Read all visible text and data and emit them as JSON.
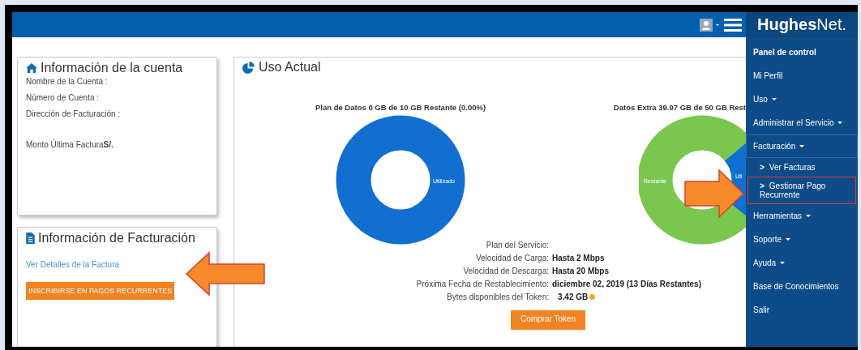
{
  "header": {
    "logo": "**Hughes**Net."
  },
  "account_card": {
    "title": "Información de la cuenta",
    "fields": [
      {
        "label": "Nombre de la Cuenta :"
      },
      {
        "label": "Número de Cuenta :"
      },
      {
        "label": "Dirección de Facturación :"
      },
      {
        "label": "Monto Última Factura",
        "value": "S/."
      }
    ]
  },
  "billing_card": {
    "title": "Información de Facturación",
    "link": "Ver Detalles de la Factura",
    "button": "INSCRIBIRSE EN PAGOS RECURRENTES"
  },
  "usage_panel": {
    "title": "Uso Actual",
    "charts": [
      {
        "title": "Plan de Datos 0 GB de 10 GB Restante (0.00%)",
        "labels": [
          "Utilizado"
        ]
      },
      {
        "title": "Datos Extra 39.97 GB de 50 GB Rest",
        "labels": [
          "Restante",
          "Uti"
        ]
      }
    ],
    "details": [
      {
        "label": "Plan del Servicio:"
      },
      {
        "label": "Velocidad de Carga:",
        "value": "Hasta 2 Mbps"
      },
      {
        "label": "Velocidad de Descarga:",
        "value": "Hasta 20 Mbps"
      },
      {
        "label": "Próxima Fecha de Restablecimiento:",
        "value": "diciembre 02, 2019 (13 Días Restantes)"
      },
      {
        "label": "Bytes disponibles del Token:",
        "value": "3.42 GB",
        "kind": "token"
      }
    ],
    "button": "Comprar Token"
  },
  "sidebar": {
    "items": [
      {
        "label": "Panel de control",
        "selected": true,
        "dropdown": false
      },
      {
        "label": "Mi Perfil",
        "selected": false,
        "dropdown": false
      },
      {
        "label": "Uso",
        "selected": false,
        "dropdown": true
      },
      {
        "label": "Administrar el Servicio",
        "selected": false,
        "dropdown": true
      },
      {
        "label": "Facturación",
        "selected": false,
        "dropdown": true,
        "expanded": true,
        "children": [
          {
            "marker": ">",
            "label": "Ver Facturas",
            "highlighted": false
          },
          {
            "marker": ">",
            "label": "Gestionar Pago Recurrente",
            "highlighted": true
          }
        ]
      },
      {
        "label": "Herramientas",
        "selected": false,
        "dropdown": true
      },
      {
        "label": "Soporte",
        "selected": false,
        "dropdown": true
      },
      {
        "label": "Ayuda",
        "selected": false,
        "dropdown": true
      },
      {
        "label": "Base de Conocimientos",
        "selected": false,
        "dropdown": false
      },
      {
        "label": "Salir",
        "selected": false,
        "dropdown": false
      }
    ]
  }
}
